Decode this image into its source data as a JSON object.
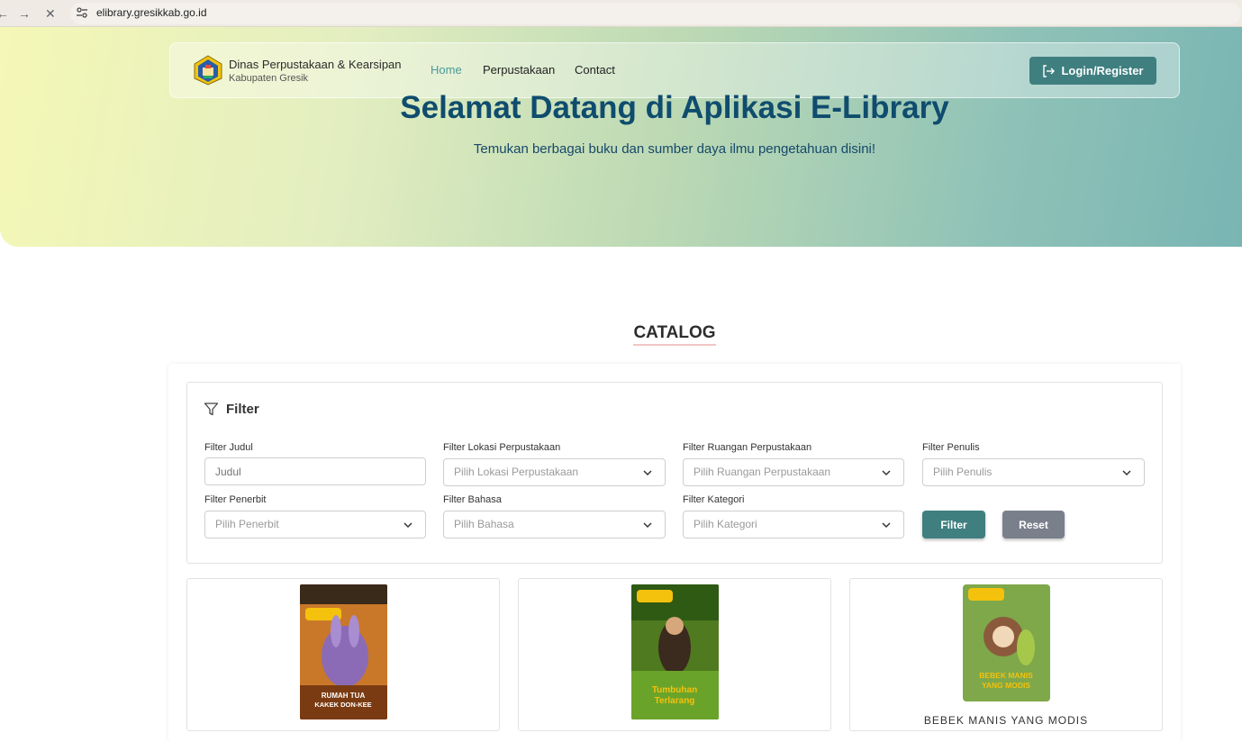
{
  "browser": {
    "back_glyph": "←",
    "forward_glyph": "→",
    "close_glyph": "✕",
    "url": "elibrary.gresikkab.go.id"
  },
  "header": {
    "org_name": "Dinas Perpustakaan & Kearsipan",
    "org_sub": "Kabupaten Gresik",
    "nav": [
      "Home",
      "Perpustakaan",
      "Contact"
    ],
    "active_nav": "Home",
    "login_label": "Login/Register"
  },
  "hero": {
    "title": "Selamat Datang di Aplikasi E-Library",
    "subtitle": "Temukan berbagai buku dan sumber daya ilmu pengetahuan disini!"
  },
  "catalog": {
    "title": "CATALOG",
    "filter_title": "Filter",
    "fields": {
      "judul": {
        "label": "Filter Judul",
        "placeholder": "Judul"
      },
      "lokasi": {
        "label": "Filter Lokasi Perpustakaan",
        "placeholder": "Pilih Lokasi Perpustakaan"
      },
      "ruangan": {
        "label": "Filter Ruangan Perpustakaan",
        "placeholder": "Pilih Ruangan Perpustakaan"
      },
      "penulis": {
        "label": "Filter Penulis",
        "placeholder": "Pilih Penulis"
      },
      "penerbit": {
        "label": "Filter Penerbit",
        "placeholder": "Pilih Penerbit"
      },
      "bahasa": {
        "label": "Filter Bahasa",
        "placeholder": "Pilih Bahasa"
      },
      "kategori": {
        "label": "Filter Kategori",
        "placeholder": "Pilih Kategori"
      }
    },
    "filter_button": "Filter",
    "reset_button": "Reset",
    "books": [
      {
        "cover_text": "RUMAH TUA KAKEK DON-KEE",
        "title": "",
        "color": "#b5651d"
      },
      {
        "cover_text": "Tumbuhan Terlarang",
        "title": "",
        "color": "#4f7a1f"
      },
      {
        "cover_text": "BEBEK MANIS YANG MODIS",
        "title": "BEBEK MANIS YANG MODIS",
        "color": "#6b8f3a"
      }
    ]
  },
  "colors": {
    "accent": "#3f7f80",
    "hero_title": "#0f4c6e",
    "reset": "#7a7f8c"
  }
}
